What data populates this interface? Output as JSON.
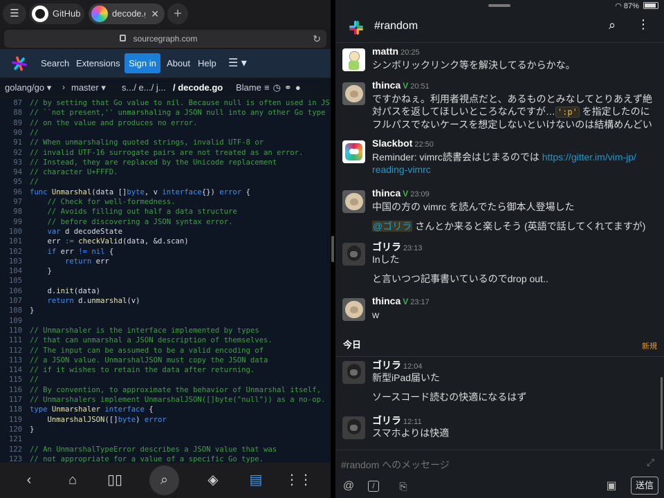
{
  "browser": {
    "tabs": [
      {
        "label": "GitHub",
        "active": false
      },
      {
        "label": "decode.go",
        "active": true
      }
    ],
    "url": "sourcegraph.com",
    "nav": {
      "search": "Search",
      "extensions": "Extensions",
      "sign_in": "Sign in",
      "about": "About",
      "help": "Help",
      "menu": "☰ ▾"
    },
    "breadcrumb": {
      "repo": "golang/go ▾",
      "sep": "›",
      "branch": "master ▾",
      "path": "s.../ e.../ j...",
      "file": "/ decode.go",
      "blame": "Blame"
    },
    "code_lines": [
      {
        "n": "87",
        "parts": [
          {
            "c": "c",
            "s": "// by setting that Go value to nil. Because null is often used in JS"
          }
        ]
      },
      {
        "n": "88",
        "parts": [
          {
            "c": "c",
            "s": "// ``not present,'' unmarshaling a JSON null into any other Go type"
          }
        ]
      },
      {
        "n": "89",
        "parts": [
          {
            "c": "c",
            "s": "// on the value and produces no error."
          }
        ]
      },
      {
        "n": "90",
        "parts": [
          {
            "c": "c",
            "s": "//"
          }
        ]
      },
      {
        "n": "91",
        "parts": [
          {
            "c": "c",
            "s": "// When unmarshaling quoted strings, invalid UTF-8 or"
          }
        ]
      },
      {
        "n": "92",
        "parts": [
          {
            "c": "c",
            "s": "// invalid UTF-16 surrogate pairs are not treated as an error."
          }
        ]
      },
      {
        "n": "93",
        "parts": [
          {
            "c": "c",
            "s": "// Instead, they are replaced by the Unicode replacement"
          }
        ]
      },
      {
        "n": "94",
        "parts": [
          {
            "c": "c",
            "s": "// character U+FFFD."
          }
        ]
      },
      {
        "n": "95",
        "parts": [
          {
            "c": "c",
            "s": "//"
          }
        ]
      },
      {
        "n": "96",
        "parts": [
          {
            "c": "k",
            "s": "func "
          },
          {
            "c": "f",
            "s": "Unmarshal"
          },
          {
            "c": "t",
            "s": "(data []"
          },
          {
            "c": "k",
            "s": "byte"
          },
          {
            "c": "t",
            "s": ", v "
          },
          {
            "c": "k",
            "s": "interface"
          },
          {
            "c": "t",
            "s": "{}) "
          },
          {
            "c": "k",
            "s": "error"
          },
          {
            "c": "t",
            "s": " {"
          }
        ]
      },
      {
        "n": "97",
        "parts": [
          {
            "c": "c",
            "s": "    // Check for well-formedness."
          }
        ]
      },
      {
        "n": "98",
        "parts": [
          {
            "c": "c",
            "s": "    // Avoids filling out half a data structure"
          }
        ]
      },
      {
        "n": "99",
        "parts": [
          {
            "c": "c",
            "s": "    // before discovering a JSON syntax error."
          }
        ]
      },
      {
        "n": "100",
        "parts": [
          {
            "c": "k",
            "s": "    var "
          },
          {
            "c": "t",
            "s": "d decodeState"
          }
        ]
      },
      {
        "n": "101",
        "parts": [
          {
            "c": "t",
            "s": "    err "
          },
          {
            "c": "k",
            "s": ":="
          },
          {
            "c": "t",
            "s": " "
          },
          {
            "c": "f",
            "s": "checkValid"
          },
          {
            "c": "t",
            "s": "(data, &d.scan)"
          }
        ]
      },
      {
        "n": "102",
        "parts": [
          {
            "c": "k",
            "s": "    if "
          },
          {
            "c": "t",
            "s": "err "
          },
          {
            "c": "k",
            "s": "!="
          },
          {
            "c": "t",
            "s": " "
          },
          {
            "c": "k",
            "s": "nil"
          },
          {
            "c": "t",
            "s": " {"
          }
        ]
      },
      {
        "n": "103",
        "parts": [
          {
            "c": "k",
            "s": "        return "
          },
          {
            "c": "t",
            "s": "err"
          }
        ]
      },
      {
        "n": "104",
        "parts": [
          {
            "c": "t",
            "s": "    }"
          }
        ]
      },
      {
        "n": "105",
        "parts": [
          {
            "c": "t",
            "s": ""
          }
        ]
      },
      {
        "n": "106",
        "parts": [
          {
            "c": "t",
            "s": "    d."
          },
          {
            "c": "f",
            "s": "init"
          },
          {
            "c": "t",
            "s": "(data)"
          }
        ]
      },
      {
        "n": "107",
        "parts": [
          {
            "c": "k",
            "s": "    return "
          },
          {
            "c": "t",
            "s": "d."
          },
          {
            "c": "f",
            "s": "unmarshal"
          },
          {
            "c": "t",
            "s": "(v)"
          }
        ]
      },
      {
        "n": "108",
        "parts": [
          {
            "c": "t",
            "s": "}"
          }
        ]
      },
      {
        "n": "109",
        "parts": [
          {
            "c": "t",
            "s": ""
          }
        ]
      },
      {
        "n": "110",
        "parts": [
          {
            "c": "c",
            "s": "// Unmarshaler is the interface implemented by types"
          }
        ]
      },
      {
        "n": "111",
        "parts": [
          {
            "c": "c",
            "s": "// that can unmarshal a JSON description of themselves."
          }
        ]
      },
      {
        "n": "112",
        "parts": [
          {
            "c": "c",
            "s": "// The input can be assumed to be a valid encoding of"
          }
        ]
      },
      {
        "n": "113",
        "parts": [
          {
            "c": "c",
            "s": "// a JSON value. UnmarshalJSON must copy the JSON data"
          }
        ]
      },
      {
        "n": "114",
        "parts": [
          {
            "c": "c",
            "s": "// if it wishes to retain the data after returning."
          }
        ]
      },
      {
        "n": "115",
        "parts": [
          {
            "c": "c",
            "s": "//"
          }
        ]
      },
      {
        "n": "116",
        "parts": [
          {
            "c": "c",
            "s": "// By convention, to approximate the behavior of Unmarshal itself,"
          }
        ]
      },
      {
        "n": "117",
        "parts": [
          {
            "c": "c",
            "s": "// Unmarshalers implement UnmarshalJSON([]byte(\"null\")) as a no-op."
          }
        ]
      },
      {
        "n": "118",
        "parts": [
          {
            "c": "k",
            "s": "type "
          },
          {
            "c": "f",
            "s": "Unmarshaler "
          },
          {
            "c": "k",
            "s": "interface"
          },
          {
            "c": "t",
            "s": " {"
          }
        ]
      },
      {
        "n": "119",
        "parts": [
          {
            "c": "f",
            "s": "    UnmarshalJSON"
          },
          {
            "c": "t",
            "s": "([]"
          },
          {
            "c": "k",
            "s": "byte"
          },
          {
            "c": "t",
            "s": ") "
          },
          {
            "c": "k",
            "s": "error"
          }
        ]
      },
      {
        "n": "120",
        "parts": [
          {
            "c": "t",
            "s": "}"
          }
        ]
      },
      {
        "n": "121",
        "parts": [
          {
            "c": "t",
            "s": ""
          }
        ]
      },
      {
        "n": "122",
        "parts": [
          {
            "c": "c",
            "s": "// An UnmarshalTypeError describes a JSON value that was"
          }
        ]
      },
      {
        "n": "123",
        "parts": [
          {
            "c": "c",
            "s": "// not appropriate for a value of a specific Go type."
          }
        ]
      }
    ],
    "bottom_icons": [
      "back-icon",
      "bookmark-icon",
      "book-icon",
      "search-icon",
      "layers-icon",
      "tabs-icon",
      "grid-icon"
    ]
  },
  "slack": {
    "status": {
      "battery": "87%"
    },
    "channel": "#random",
    "messages": [
      {
        "user": "mattn",
        "time": "20:25",
        "avatar": "mattn",
        "badge": "",
        "lines": [
          [
            "シンボリックリンク等を解決してるからかな。"
          ]
        ]
      },
      {
        "user": "thinca",
        "time": "20:51",
        "avatar": "thinca",
        "badge": "V",
        "lines": [
          [
            "ですかねぇ。利用者視点だと、あるものとみなしてとりあえず絶"
          ],
          [
            "対パスを返してほしいところなんですが…",
            {
              "code": "':p'"
            },
            " を指定したのに"
          ],
          [
            "フルパスでないケースを想定しないといけないのは結構めんどい"
          ]
        ]
      },
      {
        "user": "Slackbot",
        "time": "22:50",
        "avatar": "slackbot",
        "badge": "",
        "lines": [
          [
            "Reminder: vimrc読書会はじまるのでは ",
            {
              "link": "https://gitter.im/vim-jp/"
            }
          ],
          [
            {
              "link": "reading-vimrc"
            }
          ]
        ]
      },
      {
        "user": "thinca",
        "time": "23:09",
        "avatar": "thinca",
        "badge": "V",
        "lines": [
          [
            "中国の方の vimrc を読んでたら御本人登場した"
          ],
          [
            ""
          ],
          [
            {
              "mention": "@ゴリラ"
            },
            " さんとか来ると楽しそう (英語で話してくれてますが)"
          ]
        ]
      },
      {
        "user": "ゴリラ",
        "time": "23:13",
        "avatar": "gorilla",
        "badge": "",
        "lines": [
          [
            "Inした"
          ],
          [
            ""
          ],
          [
            "と言いつつ記事書いているのでdrop out.."
          ]
        ]
      },
      {
        "user": "thinca",
        "time": "23:17",
        "avatar": "thinca",
        "badge": "V",
        "lines": [
          [
            "w"
          ]
        ]
      }
    ],
    "day_divider": {
      "label": "今日",
      "new": "新規"
    },
    "messages_today": [
      {
        "user": "ゴリラ",
        "time": "12:04",
        "avatar": "gorilla",
        "badge": "",
        "lines": [
          [
            "新型iPad届いた"
          ],
          [
            ""
          ],
          [
            "ソースコード読むの快適になるはず"
          ]
        ]
      },
      {
        "user": "ゴリラ",
        "time": "12:11",
        "avatar": "gorilla",
        "badge": "",
        "lines": [
          [
            "スマホよりは快適"
          ]
        ]
      }
    ],
    "composer": {
      "placeholder": "#random へのメッセージ",
      "send": "送信"
    }
  }
}
